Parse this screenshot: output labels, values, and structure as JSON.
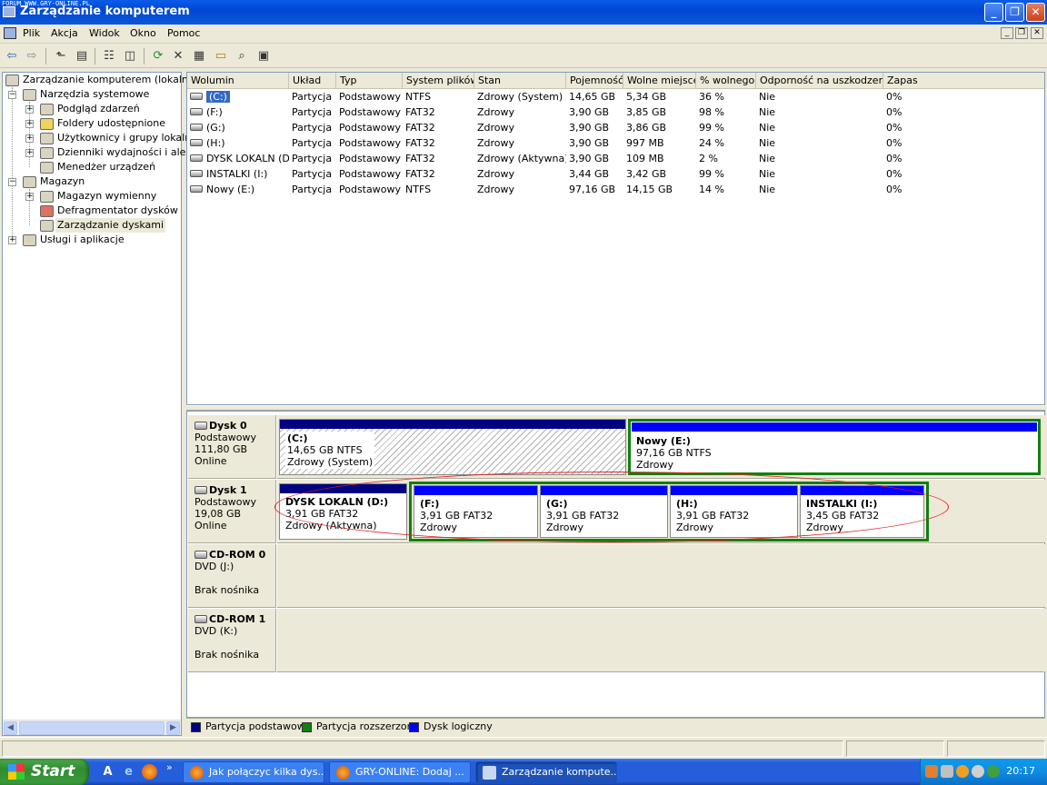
{
  "watermark": "FORUM WWW.GRY-ONLINE.PL",
  "window": {
    "title": "Zarządzanie komputerem",
    "min": "_",
    "max": "❐",
    "close": "✕"
  },
  "menu": [
    "Plik",
    "Akcja",
    "Widok",
    "Okno",
    "Pomoc"
  ],
  "mdi": {
    "min": "_",
    "restore": "❐",
    "close": "✕"
  },
  "toolbar_icons": [
    "back-arrow-icon",
    "forward-arrow-icon",
    "up-folder-icon",
    "show-hide-tree-icon",
    "properties-icon",
    "help-pane-icon",
    "refresh-icon",
    "delete-icon",
    "disk-properties-icon",
    "open-folder-icon",
    "search-icon",
    "disk-help-icon"
  ],
  "tree": {
    "root": "Zarządzanie komputerem (lokalne)",
    "system_tools": "Narzędzia systemowe",
    "event_viewer": "Podgląd zdarzeń",
    "shared_folders": "Foldery udostępnione",
    "users_groups": "Użytkownicy i grupy lokalne",
    "perf_logs": "Dzienniki wydajności i alerty",
    "device_manager": "Menedżer urządzeń",
    "storage": "Magazyn",
    "removable": "Magazyn wymienny",
    "defrag": "Defragmentator dysków",
    "disk_mgmt": "Zarządzanie dyskami",
    "services": "Usługi i aplikacje"
  },
  "volumes": {
    "columns": [
      "Wolumin",
      "Układ",
      "Typ",
      "System plików",
      "Stan",
      "Pojemność",
      "Wolne miejsce",
      "% wolnego",
      "Odporność na uszkodzenia",
      "Zapas"
    ],
    "rows": [
      [
        "(C:)",
        "Partycja",
        "Podstawowy",
        "NTFS",
        "Zdrowy (System)",
        "14,65 GB",
        "5,34 GB",
        "36 %",
        "Nie",
        "0%"
      ],
      [
        "(F:)",
        "Partycja",
        "Podstawowy",
        "FAT32",
        "Zdrowy",
        "3,90 GB",
        "3,85 GB",
        "98 %",
        "Nie",
        "0%"
      ],
      [
        "(G:)",
        "Partycja",
        "Podstawowy",
        "FAT32",
        "Zdrowy",
        "3,90 GB",
        "3,86 GB",
        "99 %",
        "Nie",
        "0%"
      ],
      [
        "(H:)",
        "Partycja",
        "Podstawowy",
        "FAT32",
        "Zdrowy",
        "3,90 GB",
        "997 MB",
        "24 %",
        "Nie",
        "0%"
      ],
      [
        "DYSK LOKALN (D:)",
        "Partycja",
        "Podstawowy",
        "FAT32",
        "Zdrowy (Aktywna)",
        "3,90 GB",
        "109 MB",
        "2 %",
        "Nie",
        "0%"
      ],
      [
        "INSTALKI (I:)",
        "Partycja",
        "Podstawowy",
        "FAT32",
        "Zdrowy",
        "3,44 GB",
        "3,42 GB",
        "99 %",
        "Nie",
        "0%"
      ],
      [
        "Nowy (E:)",
        "Partycja",
        "Podstawowy",
        "NTFS",
        "Zdrowy",
        "97,16 GB",
        "14,15 GB",
        "14 %",
        "Nie",
        "0%"
      ]
    ]
  },
  "disks": {
    "d0": {
      "name": "Dysk 0",
      "type": "Podstawowy",
      "size": "111,80 GB",
      "status": "Online"
    },
    "d1": {
      "name": "Dysk 1",
      "type": "Podstawowy",
      "size": "19,08 GB",
      "status": "Online"
    },
    "cd0": {
      "name": "CD-ROM 0",
      "drive": "DVD (J:)",
      "status": "Brak nośnika"
    },
    "cd1": {
      "name": "CD-ROM 1",
      "drive": "DVD (K:)",
      "status": "Brak nośnika"
    },
    "p_c": {
      "name": "(C:)",
      "size": "14,65 GB NTFS",
      "status": "Zdrowy (System)"
    },
    "p_e": {
      "name": "Nowy  (E:)",
      "size": "97,16 GB NTFS",
      "status": "Zdrowy"
    },
    "p_d": {
      "name": "DYSK LOKALN  (D:)",
      "size": "3,91 GB FAT32",
      "status": "Zdrowy (Aktywna)"
    },
    "p_f": {
      "name": "(F:)",
      "size": "3,91 GB FAT32",
      "status": "Zdrowy"
    },
    "p_g": {
      "name": "(G:)",
      "size": "3,91 GB FAT32",
      "status": "Zdrowy"
    },
    "p_h": {
      "name": "(H:)",
      "size": "3,91 GB FAT32",
      "status": "Zdrowy"
    },
    "p_i": {
      "name": "INSTALKI  (I:)",
      "size": "3,45 GB FAT32",
      "status": "Zdrowy"
    }
  },
  "legend": {
    "primary": "Partycja podstawowa",
    "primary_color": "#000080",
    "extended": "Partycja rozszerzona",
    "extended_color": "#108010",
    "logical": "Dysk logiczny",
    "logical_color": "#0000ff"
  },
  "taskbar": {
    "start": "Start",
    "more": "»",
    "tasks": [
      "Jak połączyc kilka dys...",
      "GRY-ONLINE: Dodaj ...",
      "Zarządzanie kompute..."
    ],
    "clock": "20:17"
  }
}
